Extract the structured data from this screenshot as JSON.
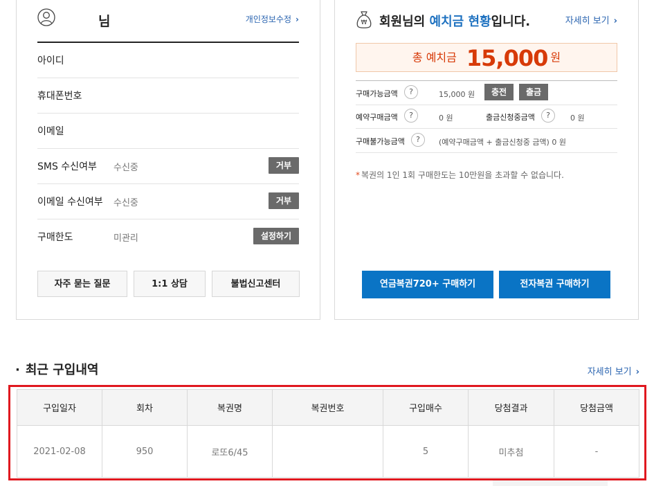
{
  "profile": {
    "name_suffix": "님",
    "edit_link": "개인정보수정",
    "rows": [
      {
        "label": "아이디",
        "value": "",
        "button": ""
      },
      {
        "label": "휴대폰번호",
        "value": "",
        "button": ""
      },
      {
        "label": "이메일",
        "value": "",
        "button": ""
      },
      {
        "label": "SMS 수신여부",
        "value": "수신중",
        "button": "거부"
      },
      {
        "label": "이메일 수신여부",
        "value": "수신중",
        "button": "거부"
      },
      {
        "label": "구매한도",
        "value": "미관리",
        "button": "설정하기"
      }
    ],
    "links": [
      "자주 묻는 질문",
      "1:1 상담",
      "불법신고센터"
    ]
  },
  "deposit": {
    "title_prefix": "회원님의 ",
    "title_highlight": "예치금 현황",
    "title_suffix": "입니다.",
    "detail_link": "자세히 보기",
    "total_label": "총 예치금",
    "total_amount": "15,000",
    "total_unit": "원",
    "available_label": "구매가능금액",
    "available_value": "15,000 원",
    "charge_button": "충전",
    "withdraw_button": "출금",
    "reserved_label": "예약구매금액",
    "reserved_value": "0 원",
    "withdraw_req_label": "출금신청중금액",
    "withdraw_req_value": "0 원",
    "unavailable_label": "구매불가능금액",
    "unavailable_value": "(예약구매금액 + 출금신청중 금액)  0 원",
    "help_mark": "?",
    "notice_star": "*",
    "notice": "복권의 1인 1회 구매한도는 10만원을 초과할 수 없습니다.",
    "buy_pension": "연금복권720+ 구매하기",
    "buy_e_lottery": "전자복권 구매하기"
  },
  "recent": {
    "bullet": "·",
    "title": "최근 구입내역",
    "more": "자세히 보기",
    "columns": [
      "구입일자",
      "회차",
      "복권명",
      "복권번호",
      "구입매수",
      "당첨결과",
      "당첨금액"
    ],
    "rows": [
      [
        "2021-02-08",
        "950",
        "로또6/45",
        "",
        "5",
        "미추첨",
        "-"
      ]
    ]
  },
  "colors": {
    "accent_blue": "#0a74c5",
    "amount_red": "#d73a08",
    "highlight_border": "#e0181f"
  }
}
